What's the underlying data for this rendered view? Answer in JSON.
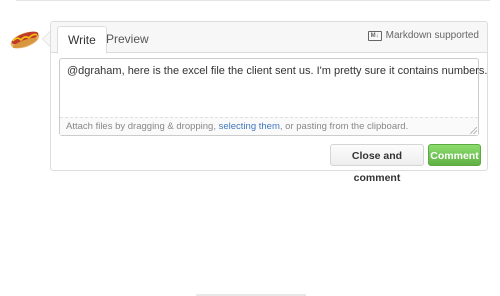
{
  "tabs": [
    {
      "label": "Write"
    },
    {
      "label": "Preview"
    }
  ],
  "markdown": {
    "icon": "markdown-icon",
    "label": "Markdown supported",
    "icon_text": "M↓"
  },
  "editor": {
    "value": "@dgraham, here is the excel file the client sent us. I'm pretty sure it contains numbers."
  },
  "attach": {
    "prefix": "Attach files by dragging & dropping, ",
    "link": "selecting them",
    "suffix": ", or pasting from the clipboard."
  },
  "buttons": {
    "close": "Close and comment",
    "comment": "Comment"
  },
  "colors": {
    "link": "#4078c0",
    "comment_green": "#60b044"
  }
}
